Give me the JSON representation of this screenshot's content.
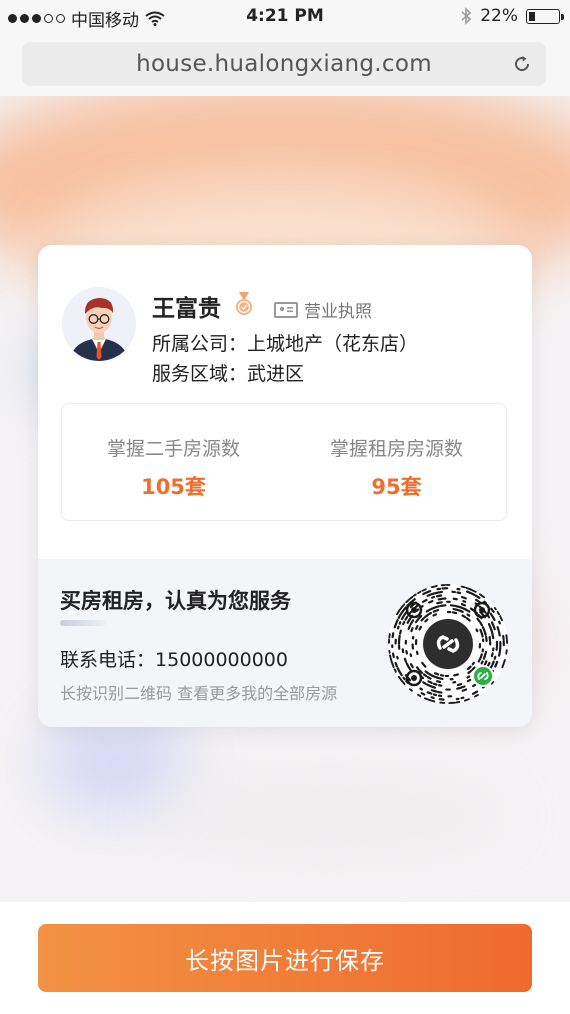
{
  "status_bar": {
    "carrier": "中国移动",
    "time": "4:21 PM",
    "battery": "22%",
    "battery_level": 0.22
  },
  "browser": {
    "url": "house.hualongxiang.com"
  },
  "agent": {
    "name": "王富贵",
    "license_label": "营业执照",
    "company_label": "所属公司：",
    "company": "上城地产（花东店）",
    "area_label": "服务区域：",
    "area": "武进区"
  },
  "stats": [
    {
      "label": "掌握二手房源数",
      "value": "105套"
    },
    {
      "label": "掌握租房房源数",
      "value": "95套"
    }
  ],
  "contact": {
    "slogan": "买房租房，认真为您服务",
    "phone_label": "联系电话：",
    "phone": "15000000000",
    "hint": "长按识别二维码 查看更多我的全部房源"
  },
  "save_button": "长按图片进行保存",
  "colors": {
    "accent": "#ef6a2f",
    "accent_light": "#f29243",
    "stat_value": "#ee6f2d",
    "wechat_green": "#2aae47"
  },
  "icons": {
    "wifi": "wifi-icon",
    "bluetooth": "bluetooth-icon",
    "reload": "reload-icon",
    "medal": "medal-icon",
    "license": "license-icon",
    "qr": "mini-program-code"
  }
}
